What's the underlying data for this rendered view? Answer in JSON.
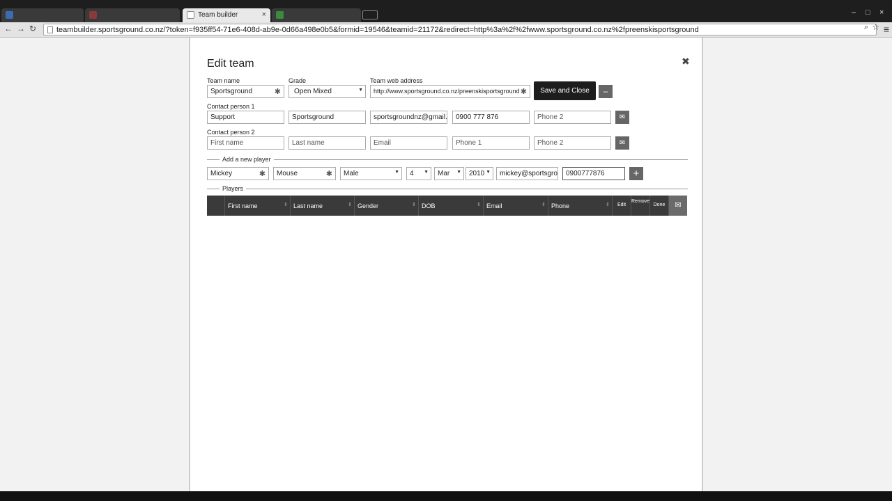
{
  "browser": {
    "tabs": [
      {
        "label": "",
        "active": false
      },
      {
        "label": "",
        "active": false
      },
      {
        "label": "Team builder",
        "active": true
      },
      {
        "label": "",
        "active": false
      }
    ],
    "tab_close": "×",
    "window_controls": [
      "–",
      "□",
      "×"
    ],
    "address": "teambuilder.sportsground.co.nz/?token=f935ff54-71e6-408d-ab9e-0d66a498e0b5&formid=19546&teamid=21172&redirect=http%3a%2f%2fwww.sportsground.co.nz%2fpreenskisportsground",
    "nav": {
      "back": "←",
      "forward": "→",
      "reload": "↻"
    },
    "search_icon": "⌕",
    "star_icon": "☆",
    "menu_icon": "≡"
  },
  "dialog": {
    "title": "Edit team",
    "close": "✖",
    "team_name_label": "Team name",
    "team_name": "Sportsground",
    "grade_label": "Grade",
    "grade": "Open Mixed",
    "web_label": "Team web address",
    "web_value": "http://www.sportsground.co.nz/preenskisportsground",
    "save_label": "Save and Close",
    "collapse_label": "–",
    "contact1_label": "Contact person 1",
    "contact1": {
      "first": "Support",
      "last": "Sportsground",
      "email": "sportsgroundnz@gmail.com",
      "phone1": "0900 777  876",
      "phone2": "Phone 2"
    },
    "contact2_label": "Contact person 2",
    "contact2": {
      "first": "First name",
      "last": "Last name",
      "email": "Email",
      "phone1": "Phone 1",
      "phone2": "Phone 2"
    },
    "email_icon": "✉",
    "required_mark": "✱",
    "add_player_label": "Add a new player",
    "new_player": {
      "first": "Mickey",
      "last": "Mouse",
      "gender": "Male",
      "day": "4",
      "month": "Mar",
      "year": "2010",
      "email": "mickey@sportsground",
      "phone": "0900777876"
    },
    "add_icon": "+",
    "players_label": "Players",
    "columns": [
      "First name",
      "Last name",
      "Gender",
      "DOB",
      "Email",
      "Phone",
      "Edit",
      "Remove",
      "Done"
    ],
    "sort_icon": "⇕"
  }
}
